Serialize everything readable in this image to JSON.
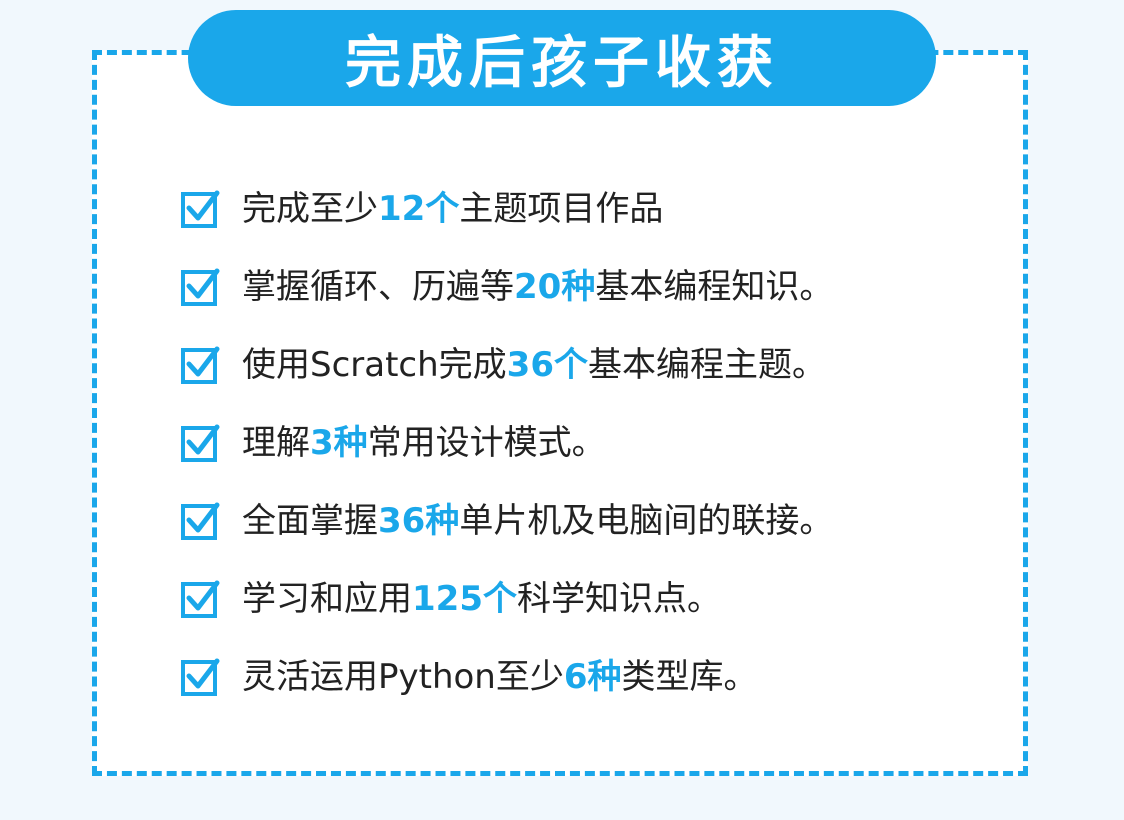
{
  "title": "完成后孩子收获",
  "colors": {
    "accent": "#1aa7ea",
    "text": "#222222",
    "background": "#f1f8fd",
    "card": "#ffffff"
  },
  "icons": {
    "bullet": "checkbox-checked-icon"
  },
  "items": [
    {
      "before": "完成至少",
      "highlight": "12个",
      "after": "主题项目作品"
    },
    {
      "before": "掌握循环、历遍等",
      "highlight": "20种",
      "after": "基本编程知识。"
    },
    {
      "before": "使用Scratch完成",
      "highlight": "36个",
      "after": "基本编程主题。"
    },
    {
      "before": "理解",
      "highlight": "3种",
      "after": "常用设计模式。"
    },
    {
      "before": "全面掌握",
      "highlight": "36种",
      "after": "单片机及电脑间的联接。"
    },
    {
      "before": "学习和应用",
      "highlight": "125个",
      "after": "科学知识点。"
    },
    {
      "before": "灵活运用Python至少",
      "highlight": "6种",
      "after": "类型库。"
    }
  ]
}
